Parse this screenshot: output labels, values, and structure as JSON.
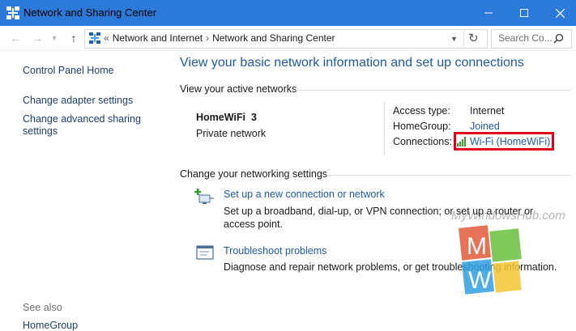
{
  "window": {
    "title": "Network and Sharing Center"
  },
  "address": {
    "crumbs": [
      "Network and Internet",
      "Network and Sharing Center"
    ],
    "prefix": "«",
    "separator": "›",
    "search_placeholder": "Search Co..."
  },
  "left": {
    "home": "Control Panel Home",
    "adapter": "Change adapter settings",
    "advanced": "Change advanced sharing settings",
    "see_also": "See also",
    "homegroup": "HomeGroup"
  },
  "main": {
    "title": "View your basic network information and set up connections",
    "active_label": "View your active networks",
    "network_name": "HomeWiFi  3",
    "network_category": "Private network",
    "access_key": "Access type:",
    "access_value": "Internet",
    "homegroup_key": "HomeGroup:",
    "homegroup_value": "Joined",
    "connections_key": "Connections:",
    "connections_value": "Wi-Fi (HomeWiFi)",
    "change_label": "Change your networking settings",
    "setup_link": "Set up a new connection or network",
    "setup_desc": "Set up a broadband, dial-up, or VPN connection; or set up a router or access point.",
    "trouble_link": "Troubleshoot problems",
    "trouble_desc": "Diagnose and repair network problems, or get troubleshooting information."
  },
  "watermark": {
    "text": "MyWindowsHub.com"
  },
  "colors": {
    "titlebar": "#2b79d8",
    "link": "#1e5aa8",
    "highlight": "#e0001b"
  }
}
